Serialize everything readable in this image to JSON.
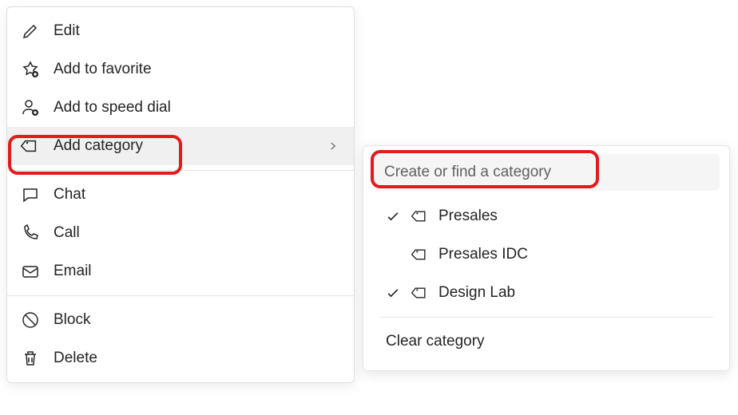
{
  "menu": {
    "edit": "Edit",
    "favorite": "Add to favorite",
    "speed_dial": "Add to speed dial",
    "add_category": "Add category",
    "chat": "Chat",
    "call": "Call",
    "email": "Email",
    "block": "Block",
    "delete": "Delete"
  },
  "submenu": {
    "search_placeholder": "Create or find a category",
    "categories": [
      {
        "label": "Presales",
        "checked": true
      },
      {
        "label": "Presales IDC",
        "checked": false
      },
      {
        "label": "Design Lab",
        "checked": true
      }
    ],
    "clear": "Clear category"
  }
}
